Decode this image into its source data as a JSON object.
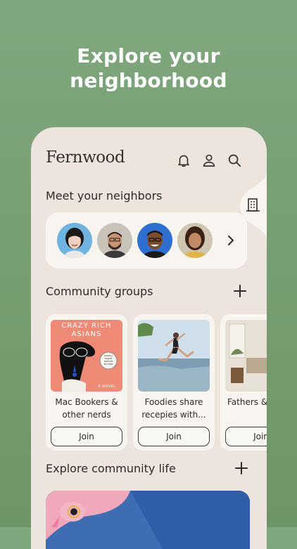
{
  "headline": {
    "line1": "Explore your",
    "line2": "neighborhood"
  },
  "app": {
    "brand": "Fernwood",
    "icons": [
      "bell-icon",
      "user-icon",
      "search-icon",
      "building-icon"
    ]
  },
  "neighbors": {
    "title": "Meet your neighbors",
    "more_icon": "chevron-right-icon"
  },
  "groups": {
    "title": "Community groups",
    "add_icon": "plus-icon",
    "items": [
      {
        "name": "Mac Bookers & other nerds",
        "button": "Join",
        "cover_title": "CRAZY RICH ASIANS",
        "cover_sub": "A NOVEL",
        "cover_badge": "SOON A MAJOR MOTION PICTURE"
      },
      {
        "name": "Foodies share recepies with...",
        "button": "Join"
      },
      {
        "name": "Fathers &",
        "button": "Join"
      }
    ]
  },
  "explore": {
    "title": "Explore community life",
    "add_icon": "plus-icon"
  },
  "colors": {
    "background": "#7fa77d",
    "panel": "#ede5dd",
    "card": "#f8f5f1",
    "text": "#2e2b28"
  }
}
